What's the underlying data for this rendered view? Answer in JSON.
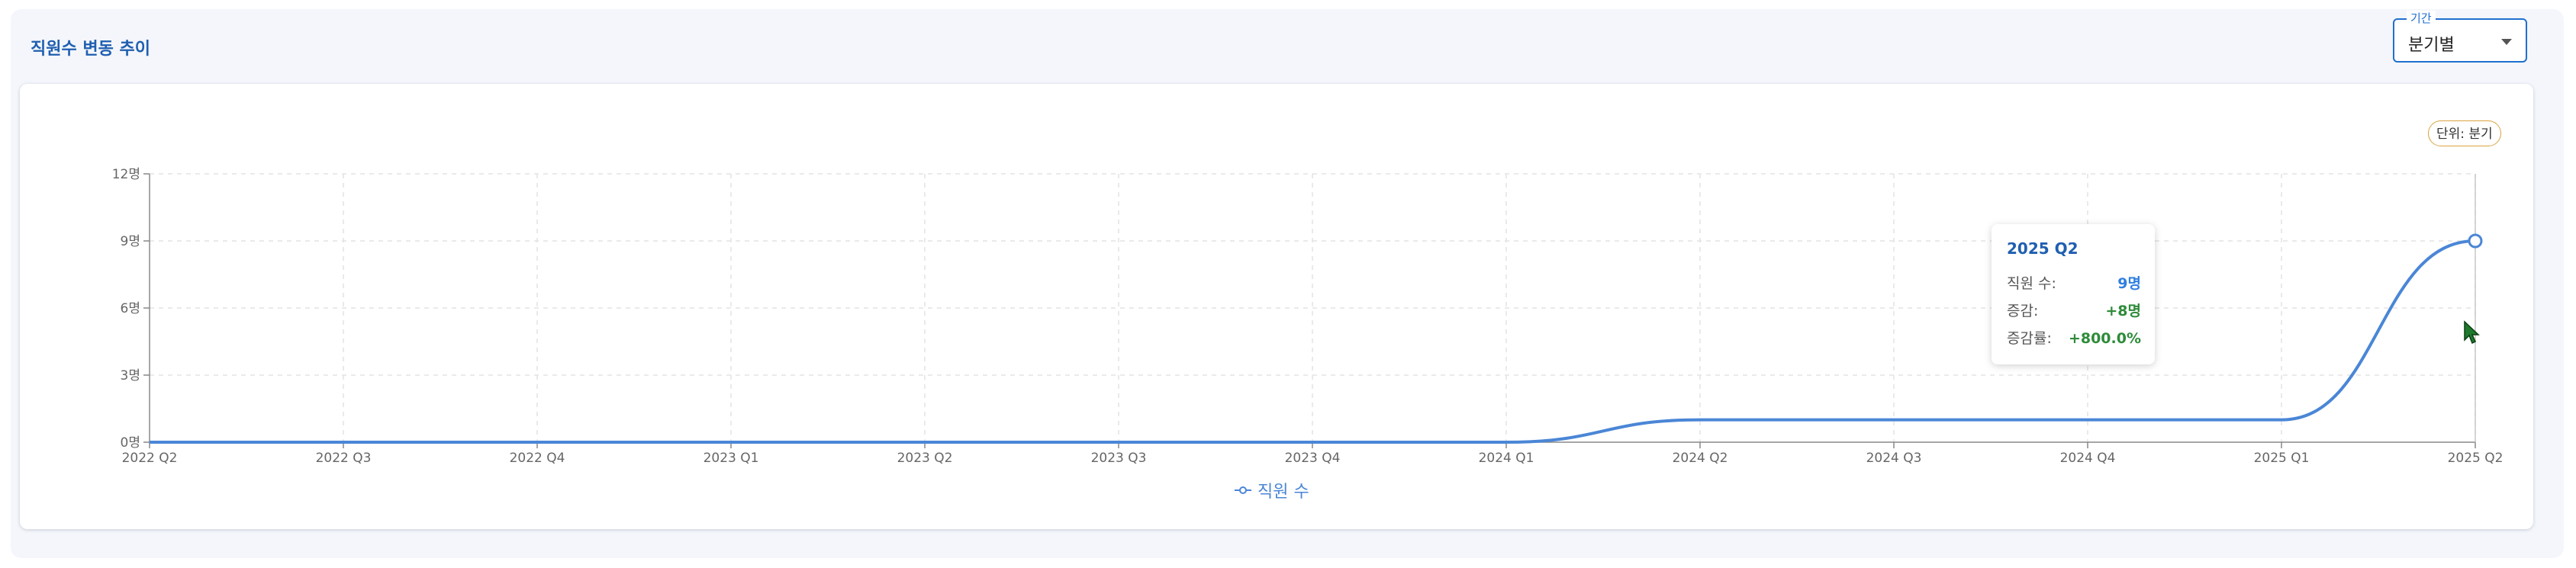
{
  "title": "직원수 변동 추이",
  "period_select": {
    "label": "기간",
    "value": "분기별"
  },
  "unit_badge": "단위: 분기",
  "colors": {
    "line": "#4a86d6",
    "accent": "#1f6fd0",
    "positive": "#2e8b3a"
  },
  "tooltip": {
    "title": "2025 Q2",
    "rows": [
      {
        "label": "직원 수:",
        "value": "9명"
      },
      {
        "label": "증감:",
        "value": "+8명"
      },
      {
        "label": "증감률:",
        "value": "+800.0%"
      }
    ]
  },
  "chart_data": {
    "type": "line",
    "categories": [
      "2022 Q2",
      "2022 Q3",
      "2022 Q4",
      "2023 Q1",
      "2023 Q2",
      "2023 Q3",
      "2023 Q4",
      "2024 Q1",
      "2024 Q2",
      "2024 Q3",
      "2024 Q4",
      "2025 Q1",
      "2025 Q2"
    ],
    "series": [
      {
        "name": "직원 수",
        "values": [
          0,
          0,
          0,
          0,
          0,
          0,
          0,
          0,
          1,
          1,
          1,
          1,
          9
        ]
      }
    ],
    "yticks": [
      "0명",
      "3명",
      "6명",
      "9명",
      "12명"
    ],
    "ylim": [
      0,
      12
    ],
    "grid": true,
    "highlighted_index": 12,
    "legend_position": "bottom-center"
  }
}
